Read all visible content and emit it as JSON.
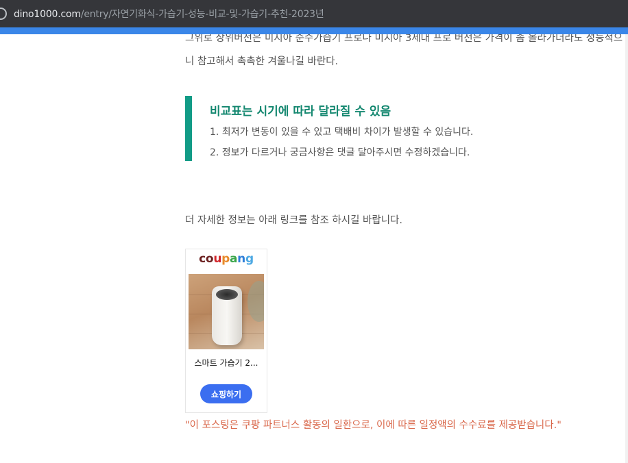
{
  "browser": {
    "url_host": "dino1000.com",
    "url_path": "/entry/자연기화식-가습기-성능-비교-및-가습기-추천-2023년"
  },
  "article": {
    "para_cut": "그위로 상위버전은 미지아 순수가습기 프로나 미지아 3세대 프로 버전은 가격이 좀 올라가더라도 성능적으",
    "para_2": "니 참고해서 촉촉한 겨울나길 바란다.",
    "quote": {
      "title": "비교표는 시기에 따라 달라질 수 있음",
      "lines": [
        "1. 최저가 변동이 있을 수 있고 택배비 차이가 발생할 수 있습니다.",
        "2. 정보가 다르거나 궁금사항은 댓글 달아주시면 수정하겠습니다."
      ]
    },
    "more_info": "더 자세한 정보는 아래 링크를 참조 하시길 바랍니다.",
    "disclaimer": "\"이 포스팅은 쿠팡 파트너스 활동의 일환으로, 이에 따른 일정액의 수수료를 제공받습니다.\""
  },
  "product_card": {
    "logo_letters": [
      "c",
      "o",
      "u",
      "p",
      "a",
      "n",
      "g"
    ],
    "logo_colors": [
      "#6b1f1f",
      "#6b1f1f",
      "#d2262b",
      "#e88a2b",
      "#3aa64a",
      "#2f7fd9",
      "#4ea9e3"
    ],
    "product_name": "스마트 가습기 2...",
    "shop_label": "쇼핑하기"
  }
}
